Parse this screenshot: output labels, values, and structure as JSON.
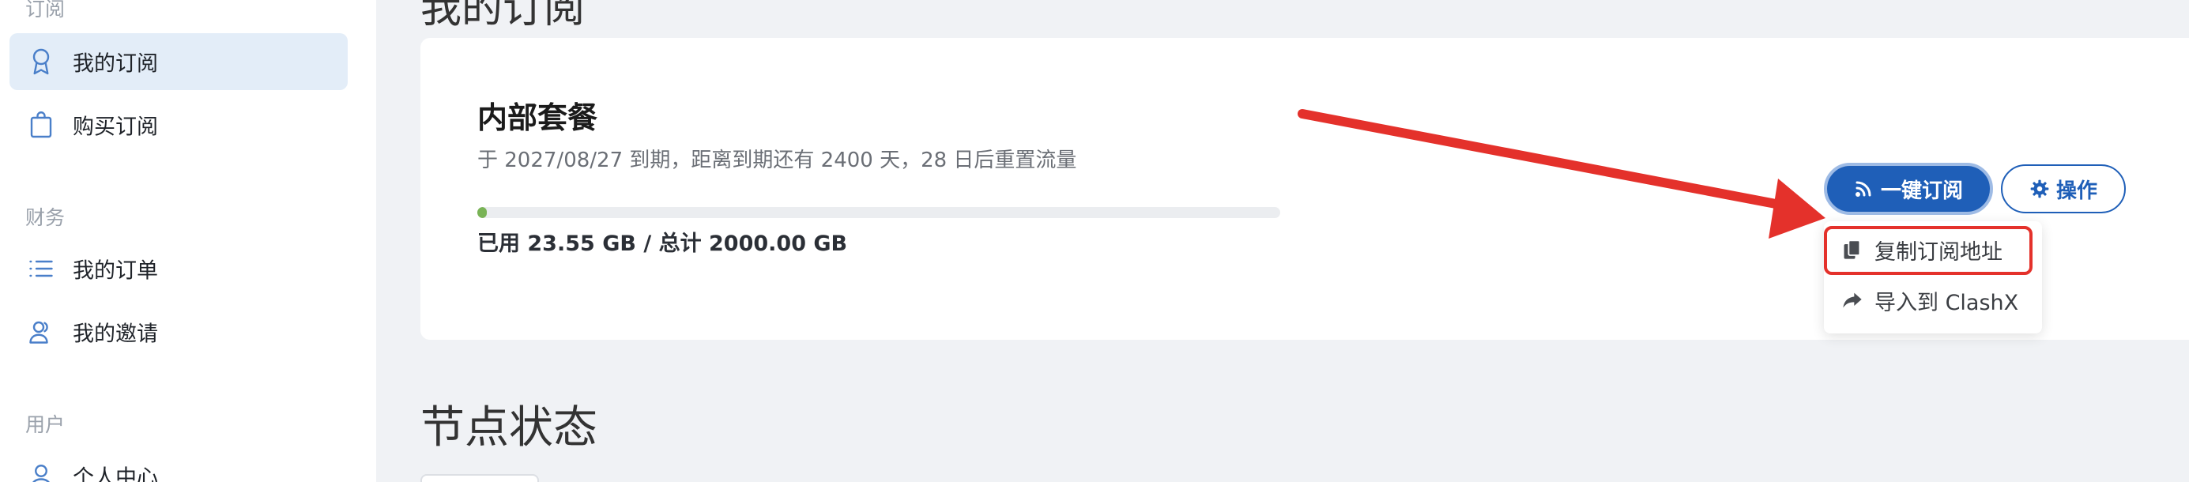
{
  "sidebar": {
    "sections": [
      {
        "label": "订阅"
      },
      {
        "label": "财务"
      },
      {
        "label": "用户"
      }
    ],
    "items": [
      {
        "label": "我的订阅",
        "icon": "award-icon",
        "active": true
      },
      {
        "label": "购买订阅",
        "icon": "shopping-bag-icon",
        "active": false
      },
      {
        "label": "我的订单",
        "icon": "list-icon",
        "active": false
      },
      {
        "label": "我的邀请",
        "icon": "users-icon",
        "active": false
      },
      {
        "label": "个人中心",
        "icon": "user-icon",
        "active": false
      }
    ]
  },
  "main": {
    "page_title": "我的订阅",
    "plan": {
      "name": "内部套餐",
      "description": "于 2027/08/27 到期，距离到期还有 2400 天，28 日后重置流量",
      "usage_text": "已用 23.55 GB / 总计 2000.00 GB",
      "used_gb": 23.55,
      "total_gb": 2000.0,
      "usage_fraction": 0.012
    },
    "buttons": {
      "subscribe_label": "一键订阅",
      "action_label": "操作"
    },
    "dropdown": {
      "items": [
        {
          "label": "复制订阅地址",
          "icon": "copy-icon"
        },
        {
          "label": "导入到 ClashX",
          "icon": "share-icon"
        }
      ]
    },
    "node_status_title": "节点状态"
  },
  "colors": {
    "primary": "#1f5fb8",
    "active_bg": "#e3edf8",
    "progress": "#79b356",
    "annotation": "#e4312b"
  }
}
